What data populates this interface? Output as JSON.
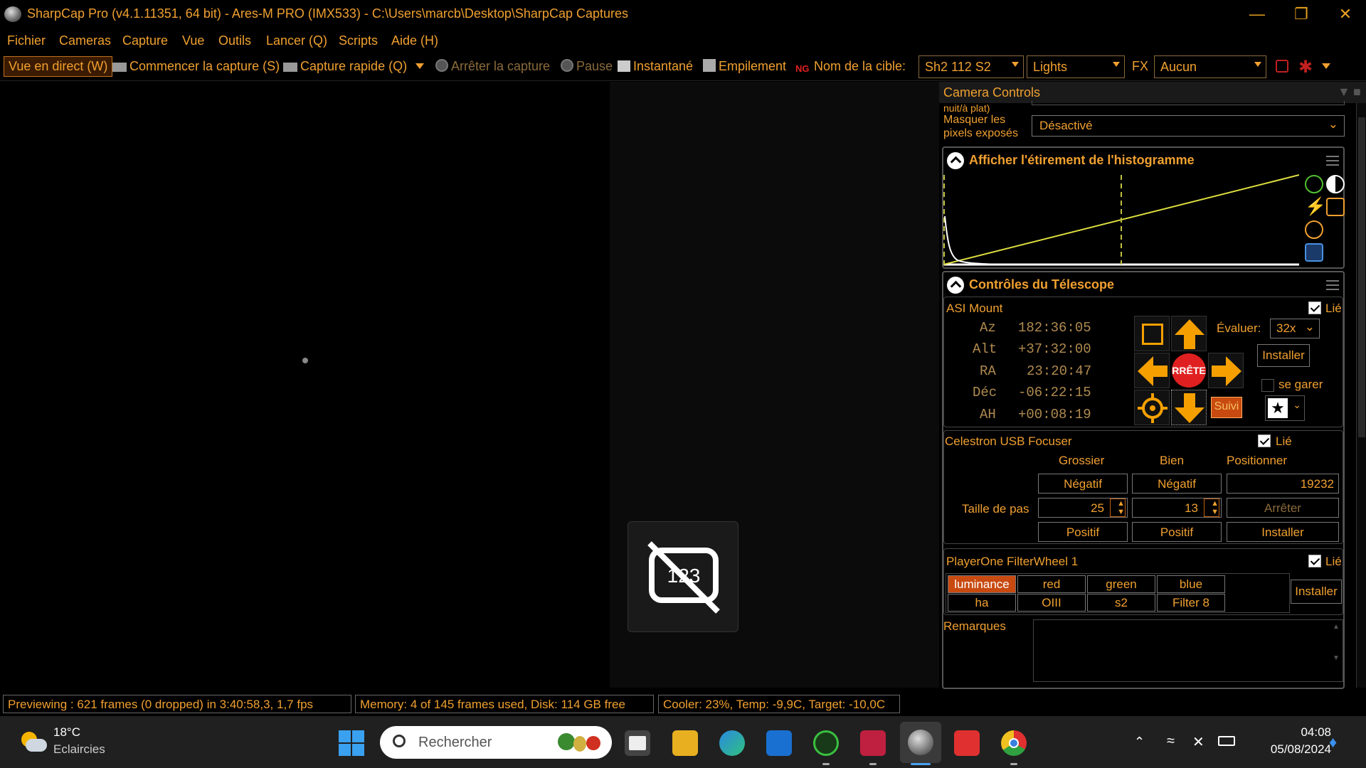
{
  "window": {
    "title": "SharpCap Pro (v4.1.11351, 64 bit) - Ares-M PRO (IMX533) - C:\\Users\\marcb\\Desktop\\SharpCap Captures"
  },
  "menu": [
    "Fichier",
    "Cameras",
    "Capture",
    "Vue",
    "Outils",
    "Lancer (Q)",
    "Scripts",
    "Aide (H)"
  ],
  "toolbar": {
    "live_view": "Vue en direct (W)",
    "start_capture": "Commencer la capture (S)",
    "quick_capture": "Capture rapide (Q)",
    "stop_capture": "Arrêter la capture",
    "pause": "Pause",
    "snapshot": "Instantané",
    "stacking": "Empilement",
    "target_label": "Nom de la cible:",
    "target_value": "Sh2 112 S2",
    "frame_type": "Lights",
    "fx_label": "FX",
    "fx_value": "Aucun"
  },
  "panel": {
    "title": "Camera Controls",
    "cut_label": "nuit/à plat)",
    "mask_label_1": "Masquer les",
    "mask_label_2": "pixels exposés",
    "mask_value": "Désactivé",
    "histogram_title": "Afficher l'étirement de l'histogramme",
    "telescope_title": "Contrôles du Télescope"
  },
  "mount": {
    "name": "ASI Mount",
    "linked_label": "Lié",
    "rows": [
      {
        "label": "Az",
        "value": "182:36:05"
      },
      {
        "label": "Alt",
        "value": "+37:32:00"
      },
      {
        "label": "RA",
        "value": "23:20:47"
      },
      {
        "label": "Déc",
        "value": "-06:22:15"
      },
      {
        "label": "AH",
        "value": "+00:08:19"
      }
    ],
    "stop_label": "RRÊTE",
    "rate_label": "Évaluer:",
    "rate_value": "32x",
    "install_label": "Installer",
    "park_label": "se garer",
    "tracking_label": "Suivi"
  },
  "focuser": {
    "name": "Celestron USB Focuser",
    "linked_label": "Lié",
    "col_coarse": "Grossier",
    "col_fine": "Bien",
    "col_position": "Positionner",
    "negative": "Négatif",
    "positive": "Positif",
    "step_label": "Taille de pas",
    "coarse_step": "25",
    "fine_step": "13",
    "position_value": "19232",
    "stop_label": "Arrêter",
    "install_label": "Installer"
  },
  "filterwheel": {
    "name": "PlayerOne FilterWheel 1",
    "linked_label": "Lié",
    "filters": [
      "luminance",
      "red",
      "green",
      "blue",
      "ha",
      "OIII",
      "s2",
      "Filter 8"
    ],
    "selected": "luminance",
    "install_label": "Installer"
  },
  "notes": {
    "label": "Remarques"
  },
  "status": {
    "preview": "Previewing : 621 frames (0 dropped) in 3:40:58,3, 1,7 fps",
    "memory": "Memory: 4 of 145 frames used, Disk: 114 GB free",
    "cooler": "Cooler: 23%, Temp: -9,9C, Target: -10,0C"
  },
  "taskbar": {
    "weather_temp": "18°C",
    "weather_desc": "Eclaircies",
    "search_placeholder": "Rechercher",
    "time": "04:08",
    "date": "05/08/2024"
  },
  "colors": {
    "accent": "#f0a030",
    "selected_filter": "#c84a10",
    "arrow": "#f5a000",
    "stop_red": "#e02020"
  }
}
